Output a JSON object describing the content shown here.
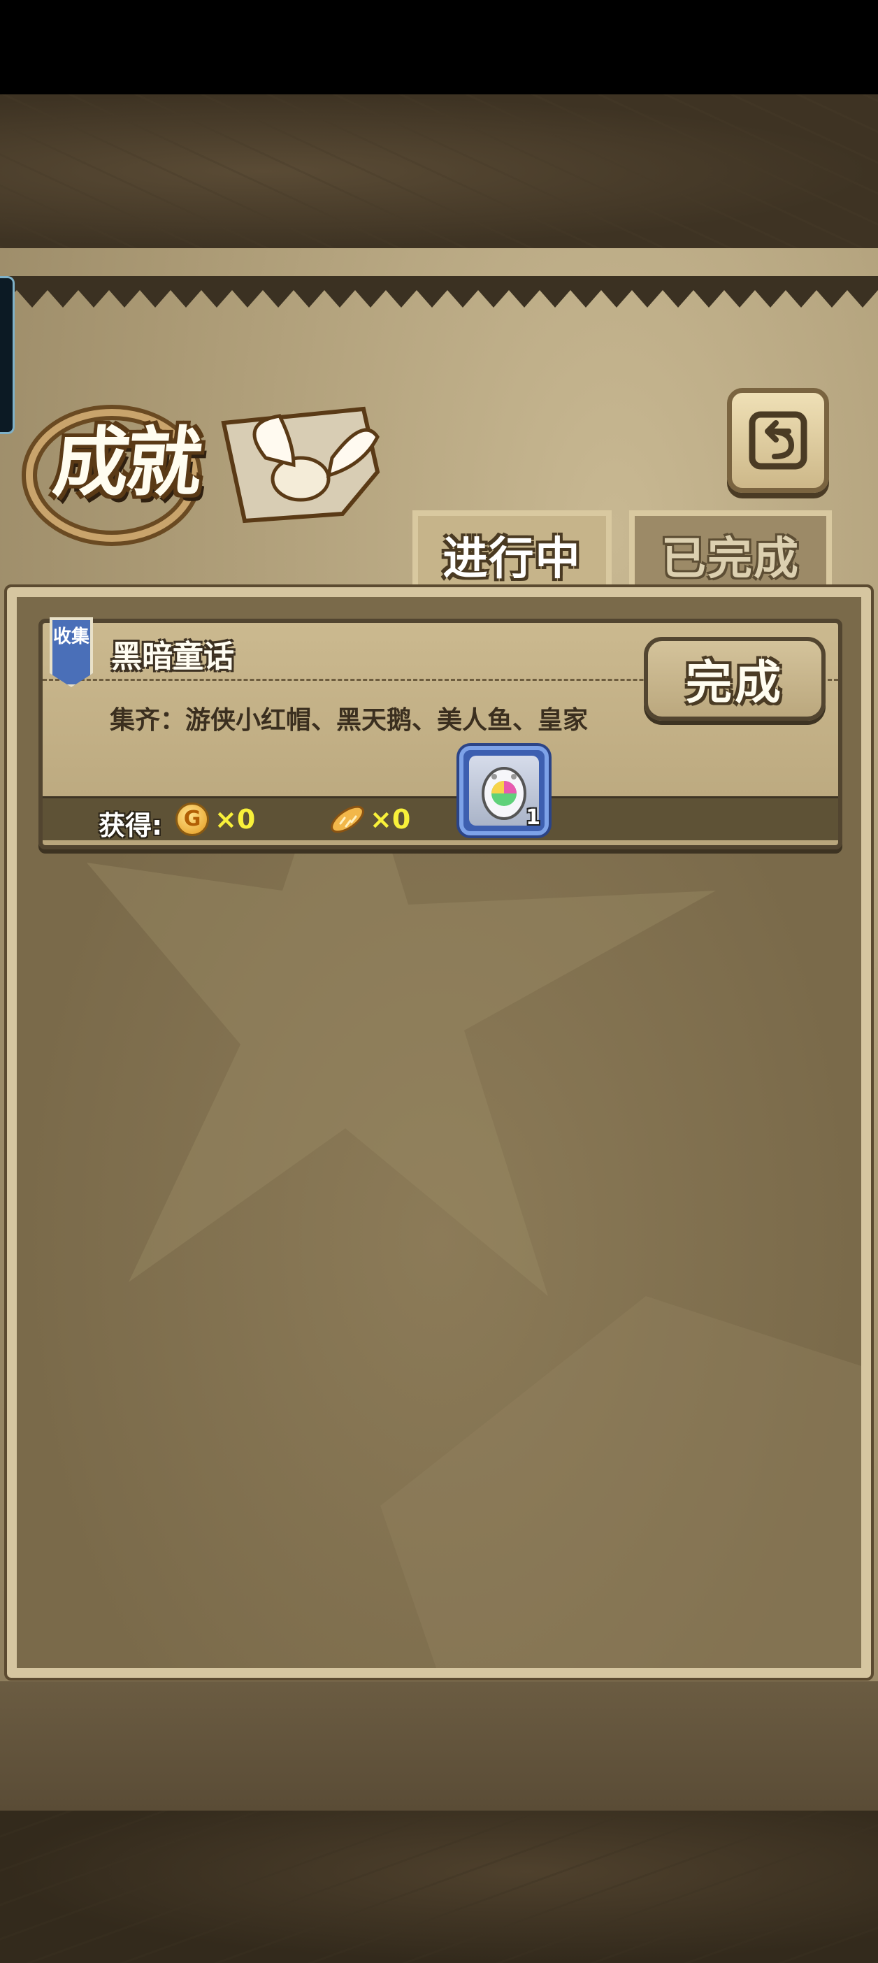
{
  "header": {
    "title": "成就"
  },
  "tabs": [
    {
      "label": "进行中",
      "active": true
    },
    {
      "label": "已完成",
      "active": false
    }
  ],
  "achievements": [
    {
      "category_badge": "收集",
      "title": "黑暗童话",
      "description": "集齐：游侠小红帽、黑天鹅、美人鱼、皇家",
      "complete_label": "完成",
      "reward_label": "获得:",
      "coin_count": "×0",
      "bread_count": "×0",
      "item_count": "1",
      "item_icon": "rainbow-egg-icon"
    }
  ],
  "colors": {
    "parchment": "#b8a67e",
    "frame": "#d6c6a0",
    "reward_text": "#f8f03a",
    "item_slot": "#3d5fb0"
  }
}
